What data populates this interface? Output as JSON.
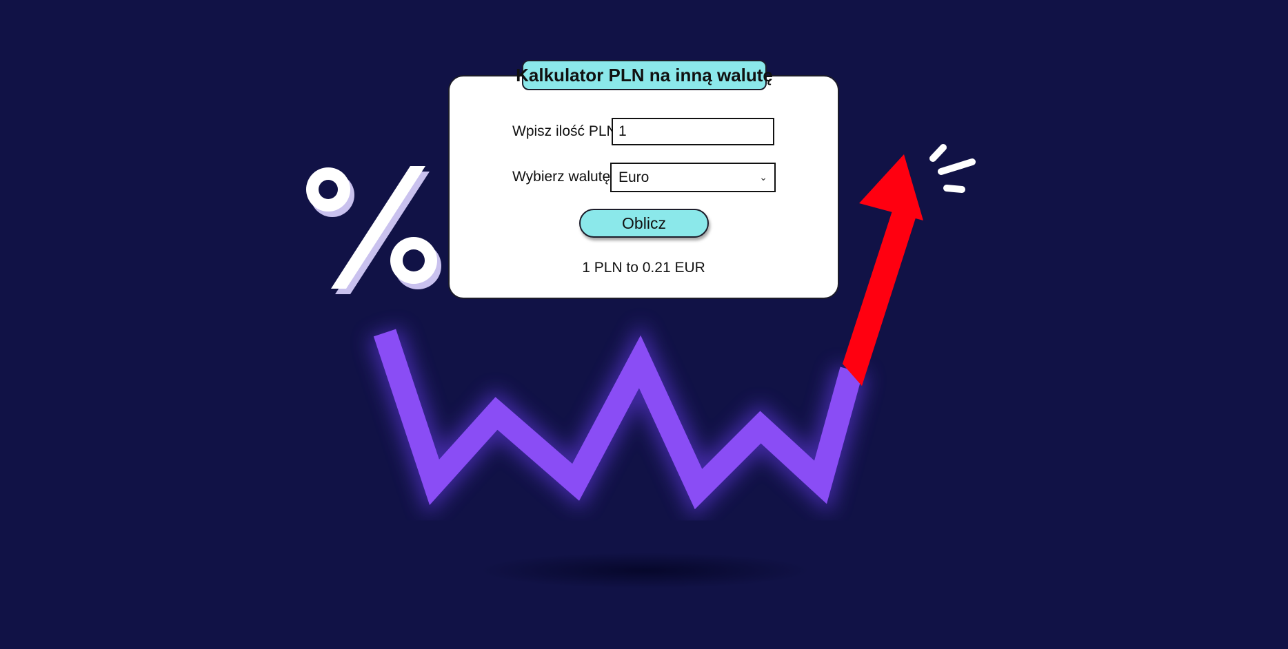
{
  "calculator": {
    "title": "Kalkulator PLN na inną walutę",
    "amount_label": "Wpisz ilość PLN",
    "amount_value": "1",
    "currency_label": "Wybierz walutę",
    "currency_selected": "Euro",
    "calculate_label": "Oblicz",
    "result": "1 PLN to 0.21 EUR"
  },
  "icons": {
    "percent": "percent-icon",
    "chart": "zigzag-chart-line",
    "arrow": "up-arrow-icon",
    "sparkle": "sparkle-lines-icon",
    "dropdown": "chevron-down-icon"
  },
  "colors": {
    "background": "#111246",
    "accent": "#8be8ea",
    "chart_line": "#8a4df5",
    "arrow": "#ff0010"
  }
}
